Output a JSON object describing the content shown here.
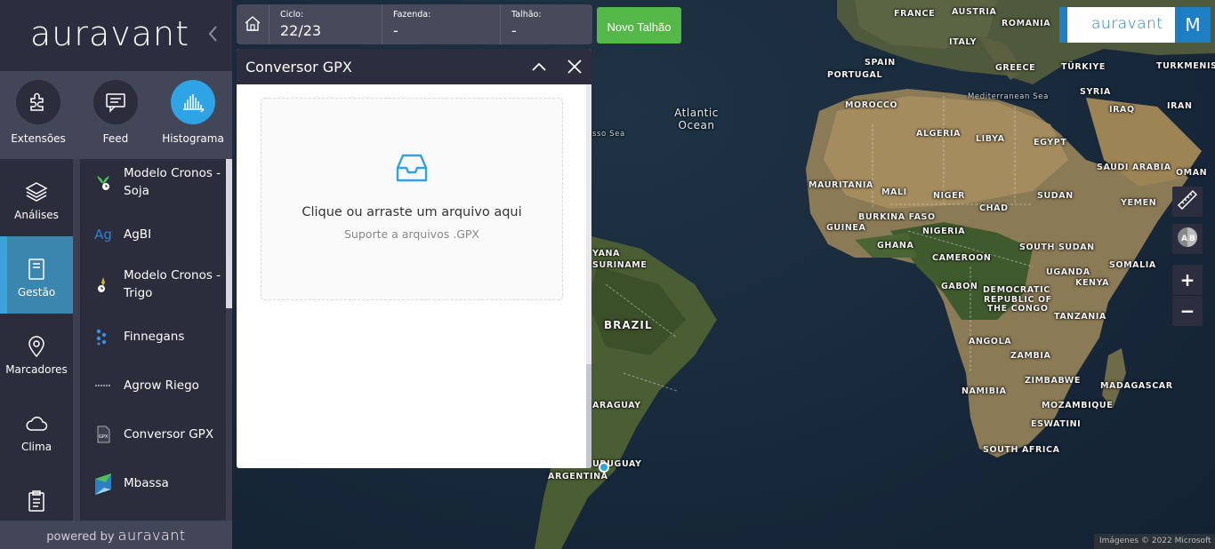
{
  "sidebar": {
    "logo": "auravant",
    "collapse_icon": "chevron-left-icon",
    "top_nav": [
      {
        "label": "Extensões",
        "icon": "puzzle-icon"
      },
      {
        "label": "Feed",
        "icon": "message-icon"
      },
      {
        "label": "Histograma",
        "icon": "histogram-icon",
        "active": true
      }
    ],
    "left_nav": [
      {
        "label": "Análises",
        "icon": "layers-icon"
      },
      {
        "label": "Gestão",
        "icon": "book-icon",
        "active": true
      },
      {
        "label": "Marcadores",
        "icon": "map-pin-icon"
      },
      {
        "label": "Clima",
        "icon": "cloud-icon"
      },
      {
        "label": "",
        "icon": "clipboard-icon"
      }
    ],
    "extensions": [
      {
        "label": "Modelo Cronos - Soja"
      },
      {
        "label": "AgBI"
      },
      {
        "label": "Modelo Cronos - Trigo"
      },
      {
        "label": "Finnegans"
      },
      {
        "label": "Agrow Riego"
      },
      {
        "label": "Conversor GPX"
      },
      {
        "label": "Mbassa"
      }
    ],
    "powered_by": "powered by",
    "powered_brand": "auravant"
  },
  "infobar": {
    "home_icon": "home-icon",
    "fields": [
      {
        "label": "Ciclo:",
        "value": "22/23"
      },
      {
        "label": "Fazenda:",
        "value": "-"
      },
      {
        "label": "Talhão:",
        "value": "-"
      }
    ],
    "new_field_button": "Novo Talhão"
  },
  "panel": {
    "title": "Conversor GPX",
    "dropzone_text": "Clique ou arraste um arquivo aqui",
    "dropzone_hint": "Suporte a arquivos .GPX"
  },
  "topright": {
    "brand": "auravant",
    "user_initial": "M"
  },
  "map_tools": [
    "ruler-icon",
    "compare-ab-icon",
    "+",
    "−"
  ],
  "copyright": "Imágenes © 2022 Microsoft",
  "map_labels": [
    {
      "text": "FRANCE"
    },
    {
      "text": "AUSTRIA"
    },
    {
      "text": "ROMANIA"
    },
    {
      "text": "ITALY"
    },
    {
      "text": "SPAIN"
    },
    {
      "text": "PORTUGAL"
    },
    {
      "text": "GREECE"
    },
    {
      "text": "TÜRKIYE"
    },
    {
      "text": "TURKMENIST"
    },
    {
      "text": "SYRIA"
    },
    {
      "text": "IRAQ"
    },
    {
      "text": "IRAN"
    },
    {
      "text": "MOROCCO"
    },
    {
      "text": "ALGERIA"
    },
    {
      "text": "LIBYA"
    },
    {
      "text": "EGYPT"
    },
    {
      "text": "SAUDI ARABIA"
    },
    {
      "text": "OMAN"
    },
    {
      "text": "MAURITANIA"
    },
    {
      "text": "MALI"
    },
    {
      "text": "NIGER"
    },
    {
      "text": "CHAD"
    },
    {
      "text": "SUDAN"
    },
    {
      "text": "YEMEN"
    },
    {
      "text": "BURKINA FASO"
    },
    {
      "text": "GUINEA"
    },
    {
      "text": "GHANA"
    },
    {
      "text": "NIGERIA"
    },
    {
      "text": "SOUTH SUDAN"
    },
    {
      "text": "CAMEROON"
    },
    {
      "text": "UGANDA"
    },
    {
      "text": "SOMALIA"
    },
    {
      "text": "KENYA"
    },
    {
      "text": "GABON"
    },
    {
      "text": "DEMOCRATIC"
    },
    {
      "text": "REPUBLIC OF"
    },
    {
      "text": "THE CONGO"
    },
    {
      "text": "TANZANIA"
    },
    {
      "text": "ANGOLA"
    },
    {
      "text": "ZAMBIA"
    },
    {
      "text": "ZIMBABWE"
    },
    {
      "text": "MADAGASCAR"
    },
    {
      "text": "NAMIBIA"
    },
    {
      "text": "MOZAMBIQUE"
    },
    {
      "text": "ESWATINI"
    },
    {
      "text": "SOUTH AFRICA"
    },
    {
      "text": "BRAZIL"
    },
    {
      "text": "SURINAME"
    },
    {
      "text": "YANA"
    },
    {
      "text": "ARAGUAY"
    },
    {
      "text": "URUGUAY"
    },
    {
      "text": "ARGENTINA"
    },
    {
      "text": "Atlantic Ocean"
    },
    {
      "text": "Mediterranean Sea"
    },
    {
      "text": "sso Sea"
    }
  ]
}
